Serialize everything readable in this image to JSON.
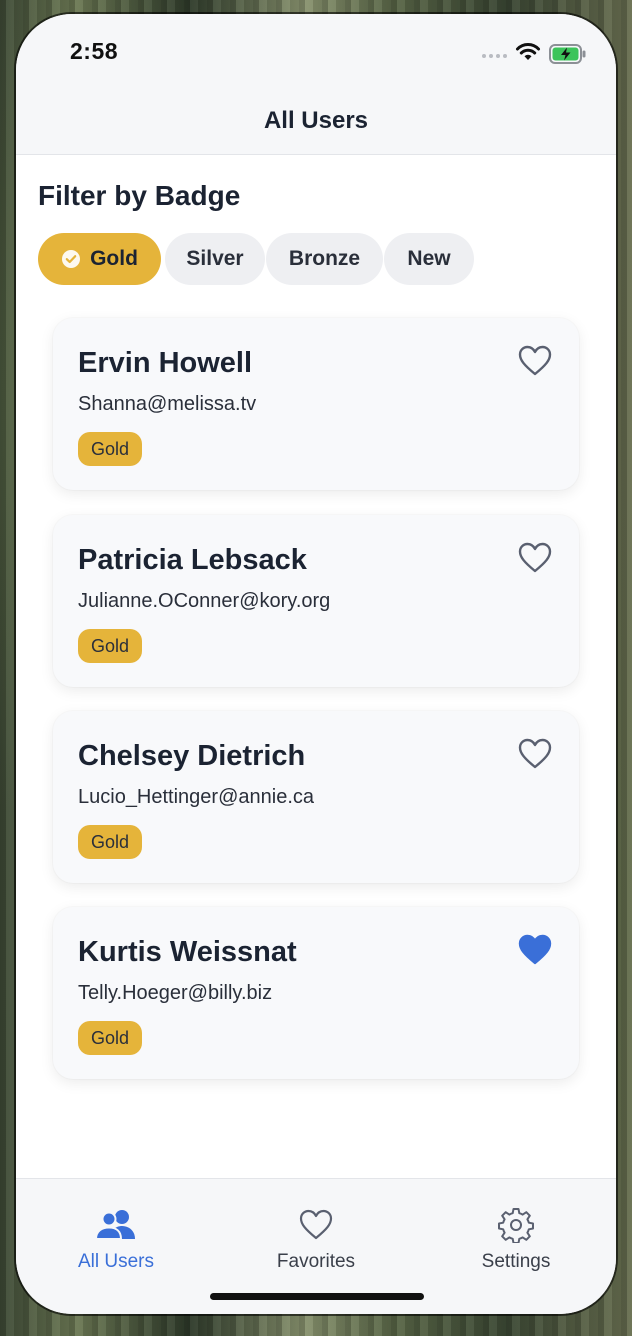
{
  "status_bar": {
    "time": "2:58"
  },
  "nav": {
    "title": "All Users"
  },
  "filter": {
    "title": "Filter by Badge",
    "chips": [
      {
        "label": "Gold",
        "selected": true
      },
      {
        "label": "Silver",
        "selected": false
      },
      {
        "label": "Bronze",
        "selected": false
      },
      {
        "label": "New",
        "selected": false
      }
    ]
  },
  "users": [
    {
      "name": "Ervin Howell",
      "email": "Shanna@melissa.tv",
      "badge": "Gold",
      "favorite": false
    },
    {
      "name": "Patricia Lebsack",
      "email": "Julianne.OConner@kory.org",
      "badge": "Gold",
      "favorite": false
    },
    {
      "name": "Chelsey Dietrich",
      "email": "Lucio_Hettinger@annie.ca",
      "badge": "Gold",
      "favorite": false
    },
    {
      "name": "Kurtis Weissnat",
      "email": "Telly.Hoeger@billy.biz",
      "badge": "Gold",
      "favorite": true
    }
  ],
  "tabbar": {
    "tabs": [
      {
        "label": "All Users",
        "icon": "users-icon",
        "active": true
      },
      {
        "label": "Favorites",
        "icon": "heart-icon",
        "active": false
      },
      {
        "label": "Settings",
        "icon": "gear-icon",
        "active": false
      }
    ]
  },
  "colors": {
    "accent": "#3a6fd8",
    "gold": "#e5b43a",
    "text": "#1b2332"
  }
}
